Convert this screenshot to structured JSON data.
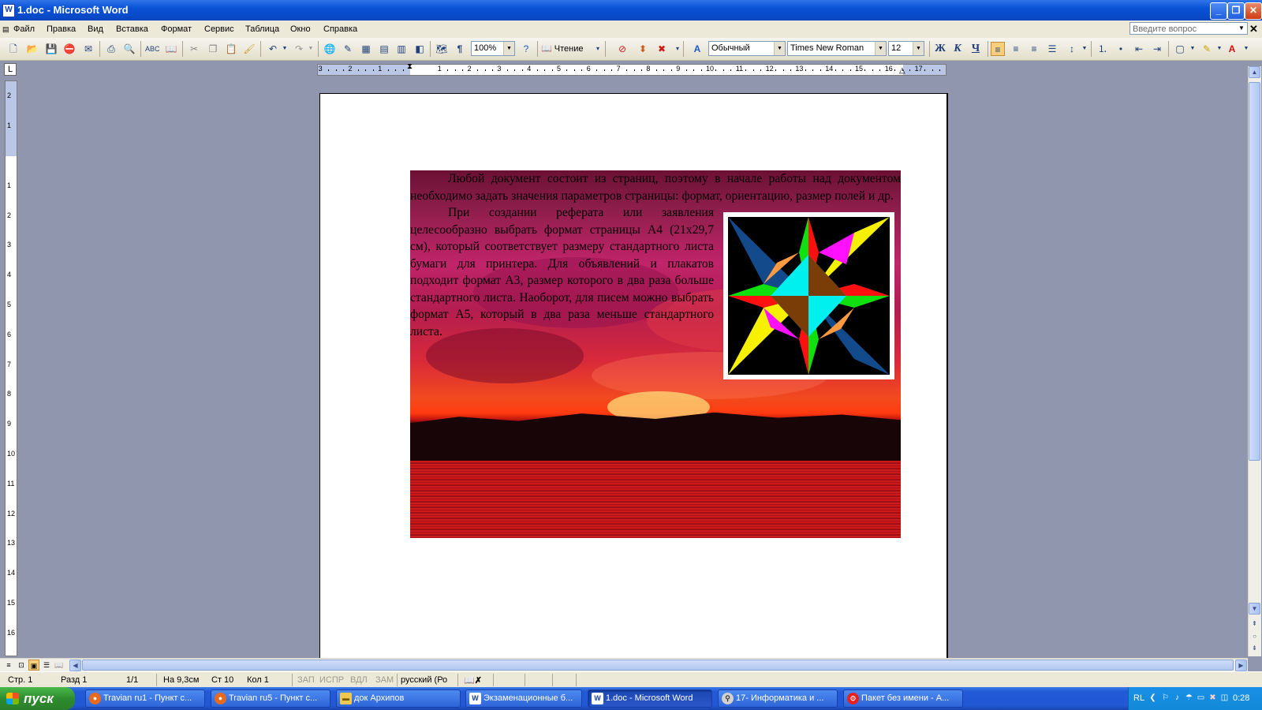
{
  "window": {
    "title": "1.doc - Microsoft Word",
    "app_icon": "W"
  },
  "menu": {
    "items": [
      "Файл",
      "Правка",
      "Вид",
      "Вставка",
      "Формат",
      "Сервис",
      "Таблица",
      "Окно",
      "Справка"
    ],
    "help_placeholder": "Введите вопрос"
  },
  "toolbar": {
    "zoom": "100%",
    "read_label": "Чтение",
    "style": "Обычный",
    "font": "Times New Roman",
    "size": "12",
    "bold": "Ж",
    "italic": "К",
    "underline": "Ч",
    "font_color_label": "A"
  },
  "ruler": {
    "h_numbers": [
      "3",
      "2",
      "1",
      "1",
      "2",
      "3",
      "4",
      "5",
      "6",
      "7",
      "8",
      "9",
      "10",
      "11",
      "12",
      "13",
      "14",
      "15",
      "16",
      "17"
    ],
    "v_numbers": [
      "2",
      "1",
      "1",
      "2",
      "3",
      "4",
      "5",
      "6",
      "7",
      "8",
      "9",
      "10",
      "11",
      "12",
      "13",
      "14",
      "15",
      "16"
    ]
  },
  "document": {
    "paragraph1": "Любой документ состоит из страниц, поэтому в начале работы над документом необходимо задать значения параметров страницы: формат, ориентацию, размер полей и др.",
    "paragraph2": "При создании реферата или заявления целесообразно выбрать формат страницы А4 (21x29,7 см), который соответствует размеру стандартного листа бумаги для принтера. Для объявлений и плакатов подходит формат А3, размер которого в два раза больше стандартного листа. Наоборот, для писем можно выбрать формат А5, который в два раза меньше стандартного листа."
  },
  "status": {
    "page": "Стр. 1",
    "section": "Разд 1",
    "pages": "1/1",
    "at": "На 9,3см",
    "line": "Ст 10",
    "col": "Кол 1",
    "rec": "ЗАП",
    "trk": "ИСПР",
    "ext": "ВДЛ",
    "ovr": "ЗАМ",
    "lang": "русский (Ро"
  },
  "taskbar": {
    "start": "пуск",
    "tasks": [
      "Travian ru1 - Пункт с...",
      "Travian ru5 - Пункт с...",
      "док Архипов",
      "Экзаменационные б...",
      "1.doc - Microsoft Word",
      "17- Информатика и ...",
      "Пакет без имени - А..."
    ],
    "lang": "RL",
    "clock": "0:28"
  },
  "colors": {
    "titlebar": "#0a52d6",
    "taskbar": "#2358d4",
    "start": "#2e8c2e",
    "page": "#ffffff"
  }
}
